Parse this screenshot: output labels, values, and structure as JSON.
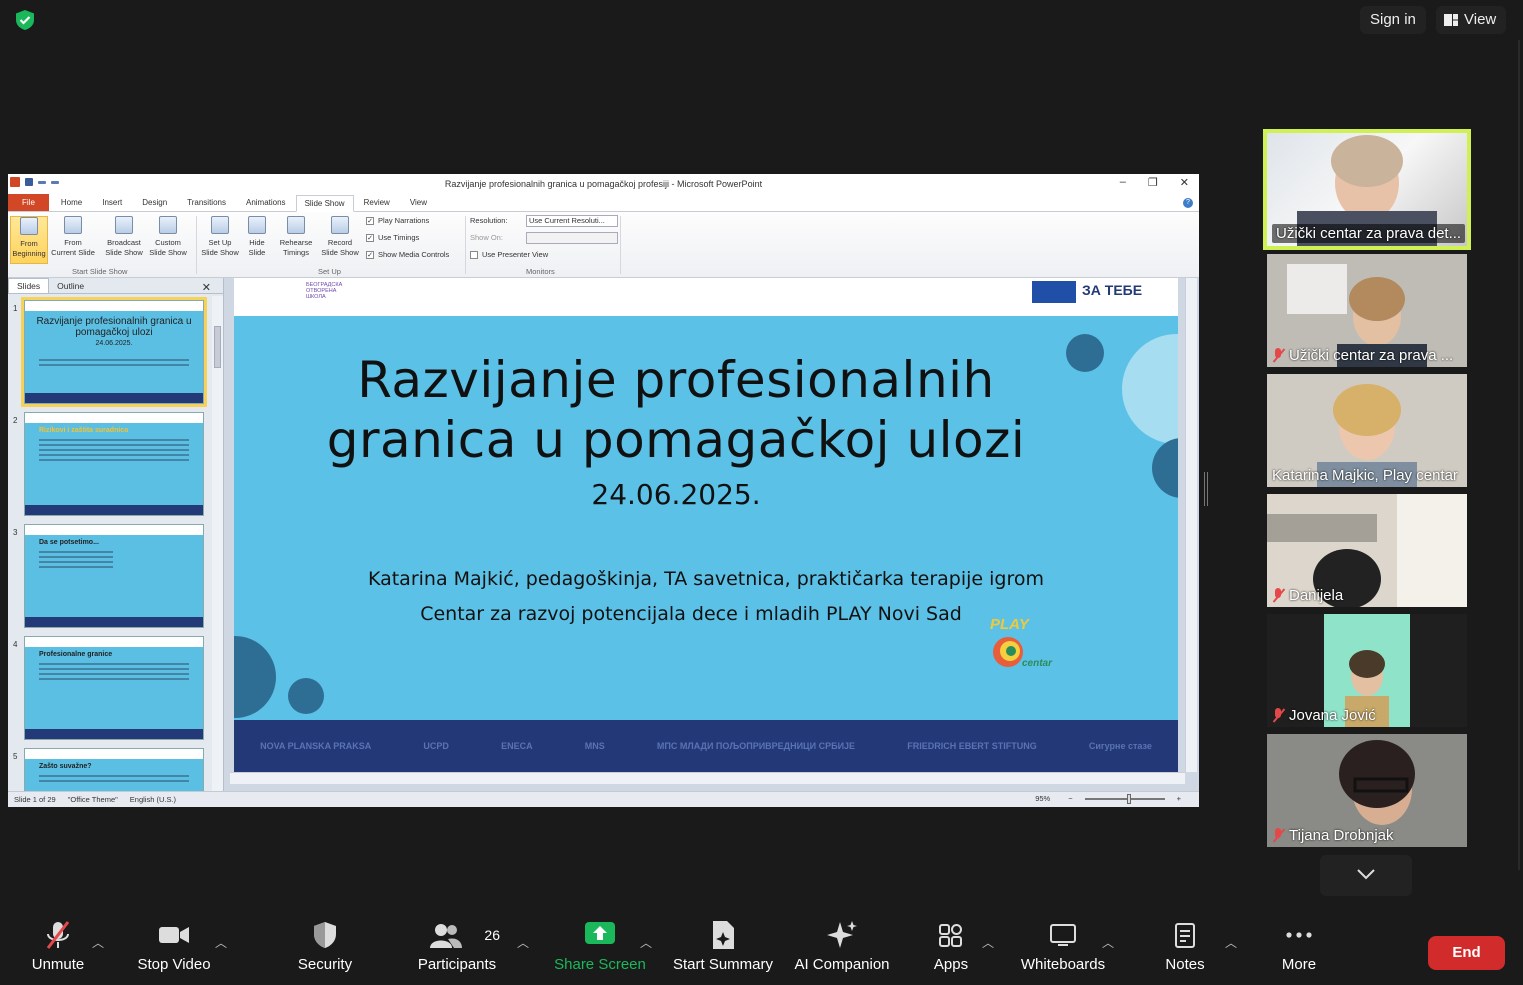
{
  "top": {
    "sign_in": "Sign in",
    "view": "View"
  },
  "ppt": {
    "window_title": "Razvijanje profesionalnih granica u pomagačkoj profesiji  -  Microsoft PowerPoint",
    "tabs": [
      "File",
      "Home",
      "Insert",
      "Design",
      "Transitions",
      "Animations",
      "Slide Show",
      "Review",
      "View"
    ],
    "ribbon": {
      "from_beginning": [
        "From",
        "Beginning"
      ],
      "from_current": [
        "From",
        "Current Slide"
      ],
      "broadcast": [
        "Broadcast",
        "Slide Show"
      ],
      "custom": [
        "Custom",
        "Slide Show"
      ],
      "group_start": "Start Slide Show",
      "setup": [
        "Set Up",
        "Slide Show"
      ],
      "hide": [
        "Hide",
        "Slide"
      ],
      "rehearse": [
        "Rehearse",
        "Timings"
      ],
      "record": [
        "Record",
        "Slide Show"
      ],
      "play_narrations": "Play Narrations",
      "use_timings": "Use Timings",
      "show_media": "Show Media Controls",
      "group_setup": "Set Up",
      "resolution_label": "Resolution:",
      "resolution_value": "Use Current Resoluti...",
      "show_on_label": "Show On:",
      "presenter_view": "Use Presenter View",
      "group_monitors": "Monitors"
    },
    "pane_tabs": [
      "Slides",
      "Outline"
    ],
    "thumbs": [
      {
        "n": "1",
        "title": "Razvijanje profesionalnih granica u pomagačkoj ulozi",
        "sub": "24.06.2025."
      },
      {
        "n": "2",
        "title": "Rizikovi i zaštita suradnica"
      },
      {
        "n": "3",
        "title": "Da se potsetimo..."
      },
      {
        "n": "4",
        "title": "Profesionalne granice"
      },
      {
        "n": "5",
        "title": "Zašto suvažne?"
      }
    ],
    "slide": {
      "title_line1": "Razvijanje profesionalnih",
      "title_line2": "granica u pomagačkoj ulozi",
      "date": "24.06.2025.",
      "author": "Katarina Majkić, pedagoškinja, TA savetnica, praktičarka terapije igrom",
      "org": "Centar za razvoj potencijala dece i mladih PLAY Novi Sad",
      "bos_text": "БЕОГРАДСКА ОТВОРЕНА ШКОЛА",
      "za_tebe": "ЗА ТЕБЕ",
      "play_logo": "PLAY",
      "play_center": "centar",
      "sponsors": [
        "NOVA PLANSKA PRAKSA",
        "UCPD",
        "ENECA",
        "MNS",
        "МПС МЛАДИ ПОЉОПРИВРЕДНИЦИ СРБИЈЕ",
        "FRIEDRICH EBERT STIFTUNG",
        "Сигурне стазе"
      ]
    },
    "status": {
      "slide": "Slide 1 of 29",
      "theme": "\"Office Theme\"",
      "lang": "English (U.S.)",
      "zoom": "95%"
    }
  },
  "participants": [
    {
      "name": "Užički centar za prava det...",
      "muted": false,
      "active": true
    },
    {
      "name": "Užički centar za prava ...",
      "muted": true
    },
    {
      "name": "Katarina Majkic, Play centar",
      "muted": false
    },
    {
      "name": "Danijela",
      "muted": true
    },
    {
      "name": "Jovana Jović",
      "muted": true
    },
    {
      "name": "Tijana Drobnjak",
      "muted": true
    }
  ],
  "toolbar": {
    "unmute": "Unmute",
    "stop_video": "Stop Video",
    "security": "Security",
    "participants": "Participants",
    "participants_count": "26",
    "share_screen": "Share Screen",
    "start_summary": "Start Summary",
    "ai_companion": "AI Companion",
    "apps": "Apps",
    "whiteboards": "Whiteboards",
    "notes": "Notes",
    "more": "More",
    "end": "End"
  },
  "colors": {
    "accent_green": "#1ab85a",
    "end_red": "#d22b2b",
    "active_speaker": "#cff153",
    "slide_blue": "#5cc1e7",
    "slide_navy": "#233877"
  }
}
